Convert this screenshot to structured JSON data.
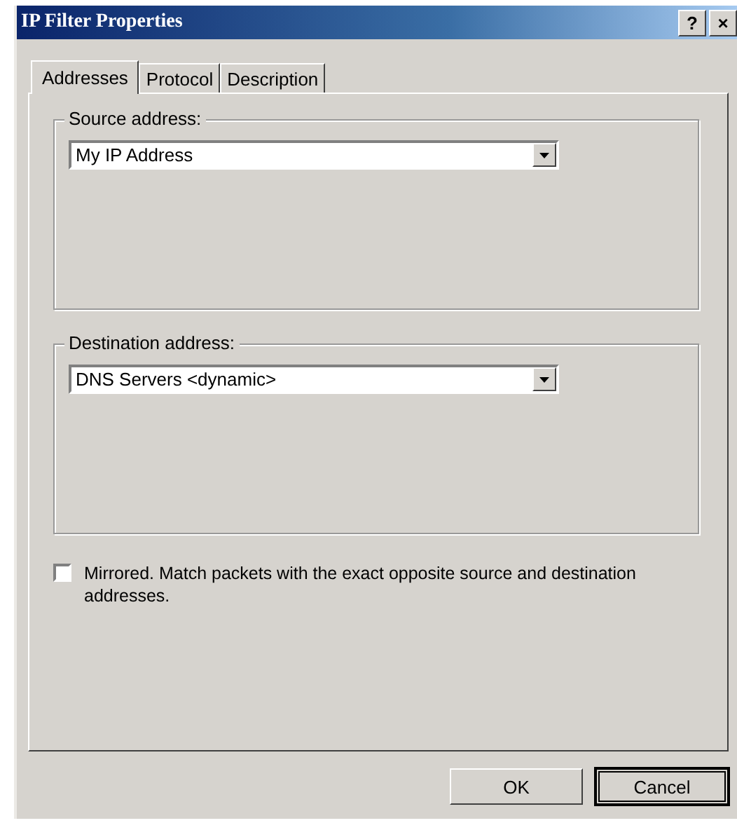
{
  "window": {
    "title": "IP Filter Properties",
    "help_button": "?",
    "close_button": "×"
  },
  "tabs": [
    {
      "label": "Addresses",
      "selected": true
    },
    {
      "label": "Protocol",
      "selected": false
    },
    {
      "label": "Description",
      "selected": false
    }
  ],
  "groups": [
    {
      "label": "Source address:",
      "value": "My IP Address"
    },
    {
      "label": "Destination address:",
      "value": "DNS Servers <dynamic>"
    }
  ],
  "mirrored": {
    "label": "Mirrored. Match packets with the exact opposite source and destination addresses.",
    "checked": false
  },
  "buttons": [
    {
      "label": "OK",
      "default": false
    },
    {
      "label": "Cancel",
      "default": true
    }
  ]
}
